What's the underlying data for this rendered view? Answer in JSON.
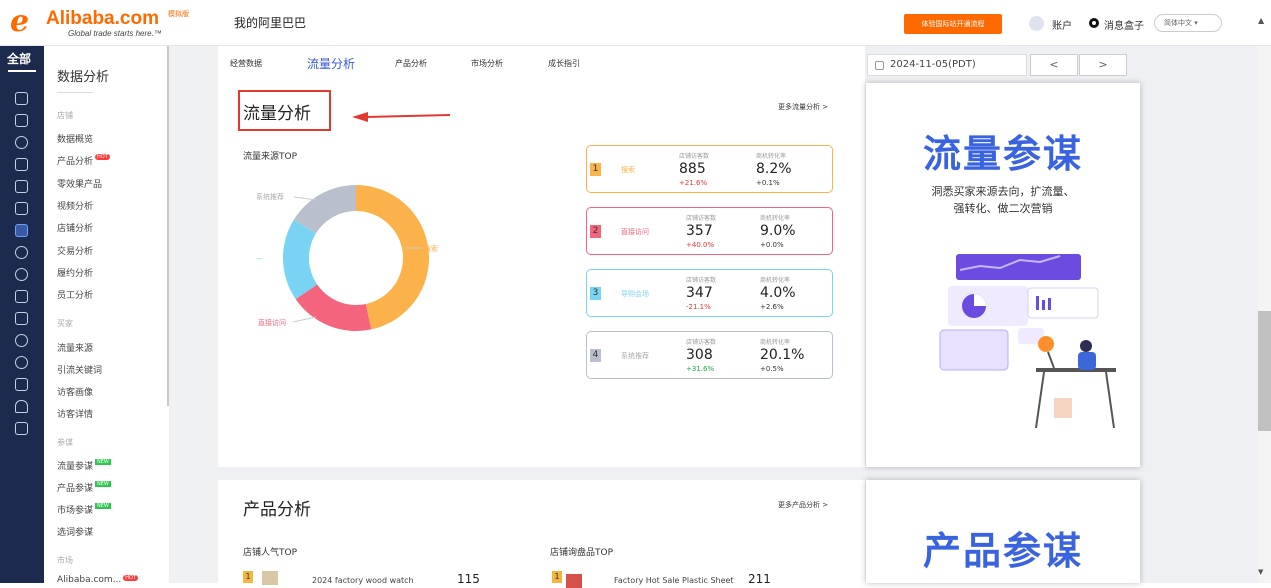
{
  "header": {
    "brand": "Alibaba.com",
    "brand_badge": "模拟版",
    "tagline": "Global trade starts here.™",
    "site_title": "我的阿里巴巴",
    "promo_button": "体验国际站开通流程",
    "account": "账户",
    "messages": "消息盒子",
    "language": "简体中文 ▾"
  },
  "icon_rail": {
    "all_label": "全部",
    "icons": [
      "home-icon",
      "store-icon",
      "shield-icon",
      "wallet-icon",
      "video-icon",
      "monitor-icon",
      "chart-icon",
      "users-icon",
      "broadcast-icon",
      "card-icon",
      "clipboard-icon",
      "globe-icon",
      "person-icon",
      "database-icon",
      "plant-icon",
      "briefcase-icon"
    ]
  },
  "sidebar": {
    "title": "数据分析",
    "sec_store": "店铺",
    "store_items": [
      "数据概览",
      "产品分析",
      "零效果产品",
      "视频分析",
      "店铺分析",
      "交易分析",
      "履约分析",
      "员工分析"
    ],
    "hot_badge": "HOT",
    "sec_buyer": "买家",
    "buyer_items": [
      "流量来源",
      "引流关键词",
      "访客画像",
      "访客详情"
    ],
    "sec_strategy": "参谋",
    "strategy_items": [
      "流量参谋",
      "产品参谋",
      "市场参谋",
      "选词参谋"
    ],
    "new_badge": "NEW",
    "sec_market": "市场",
    "market_items": [
      "Alibaba.com..."
    ]
  },
  "tabs": {
    "items": [
      "经营数据",
      "流量分析",
      "产品分析",
      "市场分析",
      "成长指引"
    ],
    "active": "流量分析"
  },
  "date_range": {
    "value": "2024-11-05(PDT)",
    "prev": "<",
    "next": ">"
  },
  "traffic": {
    "title": "流量分析",
    "more": "更多流量分析 >",
    "subtitle": "流量来源TOP",
    "chart_labels": {
      "system": "系统推荐",
      "search": "搜索",
      "direct": "直接访问",
      "blank": "—"
    },
    "col_visitors": "店铺访客数",
    "col_conversion": "商机转化率",
    "cards": [
      {
        "rank": "1",
        "name": "搜索",
        "visitors": "885",
        "visitors_change": "+21.6%",
        "conversion": "8.2%",
        "conversion_change": "+0.1%"
      },
      {
        "rank": "2",
        "name": "直接访问",
        "visitors": "357",
        "visitors_change": "+40.0%",
        "conversion": "9.0%",
        "conversion_change": "+0.0%"
      },
      {
        "rank": "3",
        "name": "导购会场",
        "visitors": "347",
        "visitors_change": "-21.1%",
        "conversion": "4.0%",
        "conversion_change": "+2.6%"
      },
      {
        "rank": "4",
        "name": "系统推荐",
        "visitors": "308",
        "visitors_change": "+31.6%",
        "conversion": "20.1%",
        "conversion_change": "+0.5%"
      }
    ]
  },
  "ad_flow": {
    "title": "流量参谋",
    "line1": "洞悉买家来源去向，扩流量、",
    "line2": "强转化、做二次营销"
  },
  "product": {
    "title": "产品分析",
    "more": "更多产品分析 >",
    "sub_popular": "店铺人气TOP",
    "sub_inquiry": "店铺询盘品TOP",
    "popular_row": {
      "rank": "1",
      "name": "2024 factory wood watch",
      "value": "115"
    },
    "inquiry_row": {
      "rank": "1",
      "name": "Factory Hot Sale Plastic Sheet",
      "value": "211"
    }
  },
  "ad_product": {
    "title": "产品参谋"
  },
  "chart_data": {
    "type": "pie",
    "title": "流量来源TOP",
    "categories": [
      "搜索",
      "直接访问",
      "导购会场",
      "系统推荐"
    ],
    "values": [
      885,
      357,
      347,
      308
    ],
    "colors": [
      "#fbb24a",
      "#f4647c",
      "#78d4f2",
      "#b9bfcd"
    ]
  }
}
